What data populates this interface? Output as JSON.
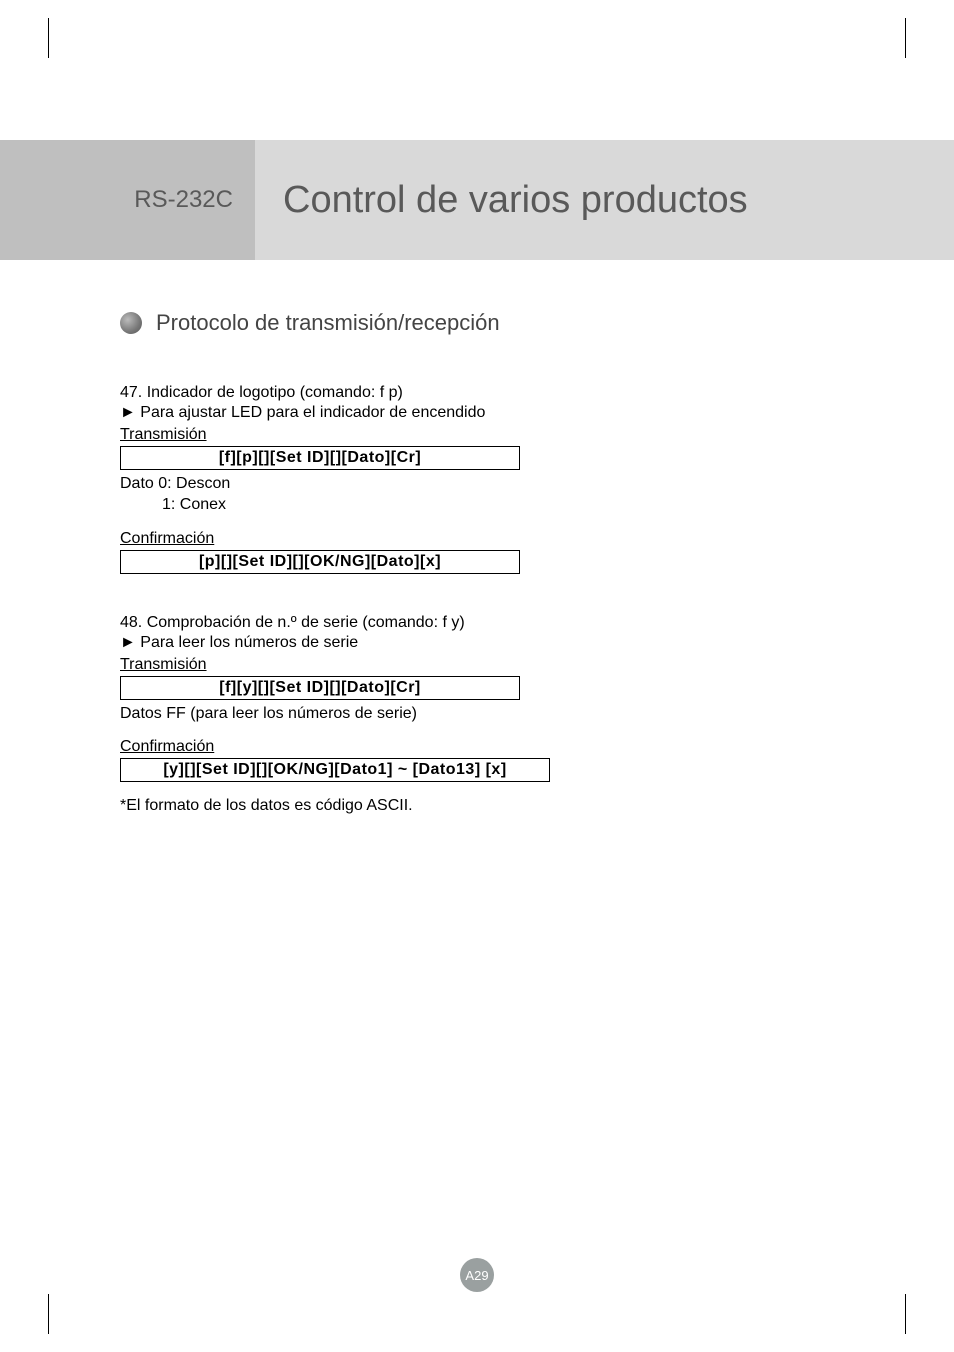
{
  "header": {
    "left": "RS-232C",
    "right": "Control de varios productos"
  },
  "section_title": "Protocolo de transmisión/recepción",
  "cmd47": {
    "title": "47. Indicador de logotipo (comando: f p)",
    "desc": "► Para ajustar LED para el indicador de encendido",
    "tx_label": "Transmisión",
    "tx_code": "[f][p][][Set ID][][Dato][Cr]",
    "data0": "Dato 0: Descon",
    "data1": "1: Conex",
    "conf_label": "Confirmación",
    "conf_code": "[p][][Set ID][][OK/NG][Dato][x]"
  },
  "cmd48": {
    "title": "48. Comprobación de n.º de serie (comando: f y)",
    "desc": "► Para leer los números de serie",
    "tx_label": "Transmisión",
    "tx_code": "[f][y][][Set ID][][Dato][Cr]",
    "data_note": "Datos FF (para leer los números de serie)",
    "conf_label": "Confirmación",
    "conf_code": "[y][][Set ID][][OK/NG][Dato1] ~ [Dato13] [x]",
    "format_note": "*El formato de los datos es código ASCII."
  },
  "page_num": "A29"
}
